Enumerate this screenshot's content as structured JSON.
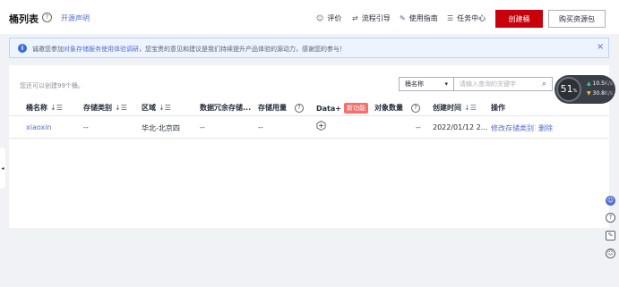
{
  "header": {
    "title": "桶列表",
    "help": "?",
    "open_link": "开源声明",
    "tools": [
      {
        "icon": "smile-icon",
        "glyph": "☺",
        "label": "评价"
      },
      {
        "icon": "flow-icon",
        "glyph": "⇄",
        "label": "流程引导"
      },
      {
        "icon": "guide-icon",
        "glyph": "✎",
        "label": "使用指南"
      },
      {
        "icon": "task-icon",
        "glyph": "☰",
        "label": "任务中心"
      }
    ],
    "create_bucket": "创建桶",
    "buy_package": "购买资源包"
  },
  "notice": {
    "icon": "i",
    "prefix": "诚邀您参加",
    "link": "对象存储服务使用体验调研",
    "suffix": "，您宝贵的意见和建议是我们持续提升产品体验的源动力，感谢您的参与！",
    "close": "×"
  },
  "panel": {
    "hint": "您还可以创建99个桶。",
    "filter_select": "桶名称",
    "search_placeholder": "请输入查询的关键字"
  },
  "table": {
    "headers": {
      "name": "桶名称",
      "storage_class": "存储类别",
      "region": "区域",
      "redundancy": "数据冗余存储...",
      "usage": "存储用量",
      "dataplus": "Data+",
      "new_badge": "新功能",
      "objects": "对象数量",
      "created": "创建时间",
      "actions": "操作"
    },
    "rows": [
      {
        "name": "xiaoxin",
        "storage_class": "--",
        "region": "华北-北京四",
        "redundancy": "--",
        "usage": "--",
        "objects": "--",
        "created": "2022/01/12 2...",
        "action_modify": "修改存储类别",
        "action_delete": "删除"
      }
    ]
  },
  "speed_widget": {
    "percent": "51",
    "unit": "%",
    "up": "10.5",
    "up_unit": "K/s",
    "down": "30.8",
    "down_unit": "K/s"
  },
  "colors": {
    "primary_red": "#c7000b",
    "link_blue": "#526ecc",
    "notice_bg": "#eef4ff",
    "badge_red": "#f66f6a"
  }
}
